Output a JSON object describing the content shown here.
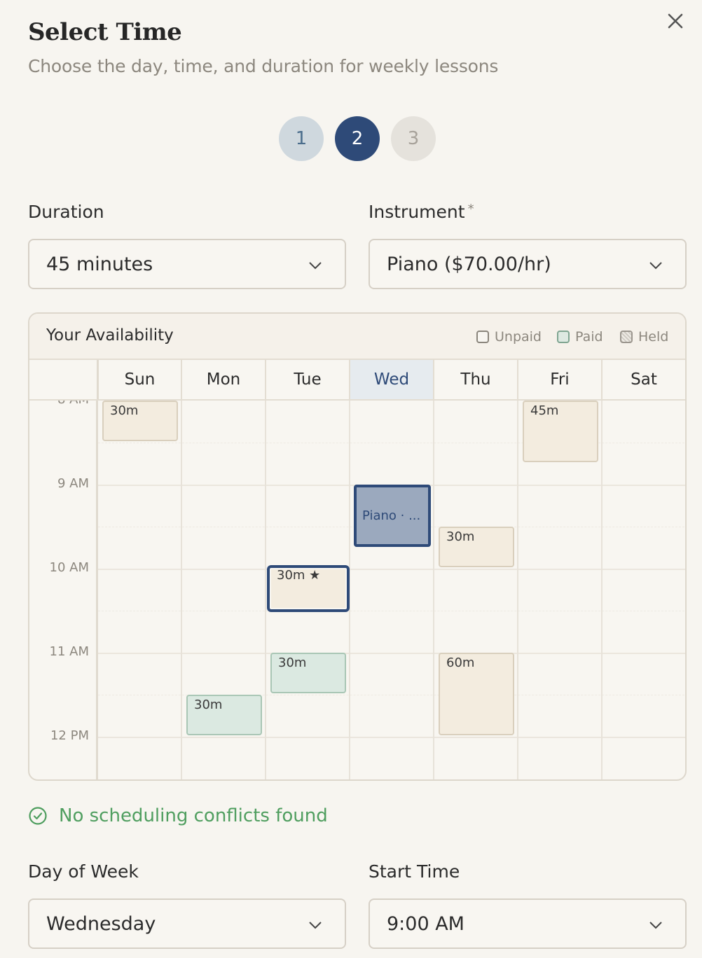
{
  "dialog": {
    "title": "Select Time",
    "subtitle": "Choose the day, time, and duration for weekly lessons"
  },
  "stepper": {
    "steps": [
      "1",
      "2",
      "3"
    ],
    "current_step": 2
  },
  "duration": {
    "label": "Duration",
    "value": "45 minutes"
  },
  "instrument": {
    "label": "Instrument",
    "required_mark": "*",
    "value": "Piano ($70.00/hr)"
  },
  "availability": {
    "title": "Your Availability",
    "legend": {
      "unpaid": "Unpaid",
      "paid": "Paid",
      "held": "Held"
    },
    "days": [
      "Sun",
      "Mon",
      "Tue",
      "Wed",
      "Thu",
      "Fri",
      "Sat"
    ],
    "active_day": "Wed",
    "time_labels": [
      "8 AM",
      "9 AM",
      "10 AM",
      "11 AM",
      "12 PM"
    ],
    "blocks": {
      "sun_8am": "30m",
      "fri_8am": "45m",
      "wed_new": "Piano · ...",
      "thu_930": "30m",
      "tue_10am": "30m ★",
      "tue_11am": "30m",
      "thu_11am": "60m",
      "mon_1130": "30m"
    }
  },
  "status": {
    "message": "No scheduling conflicts found"
  },
  "day_of_week": {
    "label": "Day of Week",
    "value": "Wednesday"
  },
  "start_time": {
    "label": "Start Time",
    "value": "9:00 AM"
  },
  "colors": {
    "primary": "#2e4a78",
    "success": "#4f9e5f",
    "background": "#f7f5f0"
  }
}
